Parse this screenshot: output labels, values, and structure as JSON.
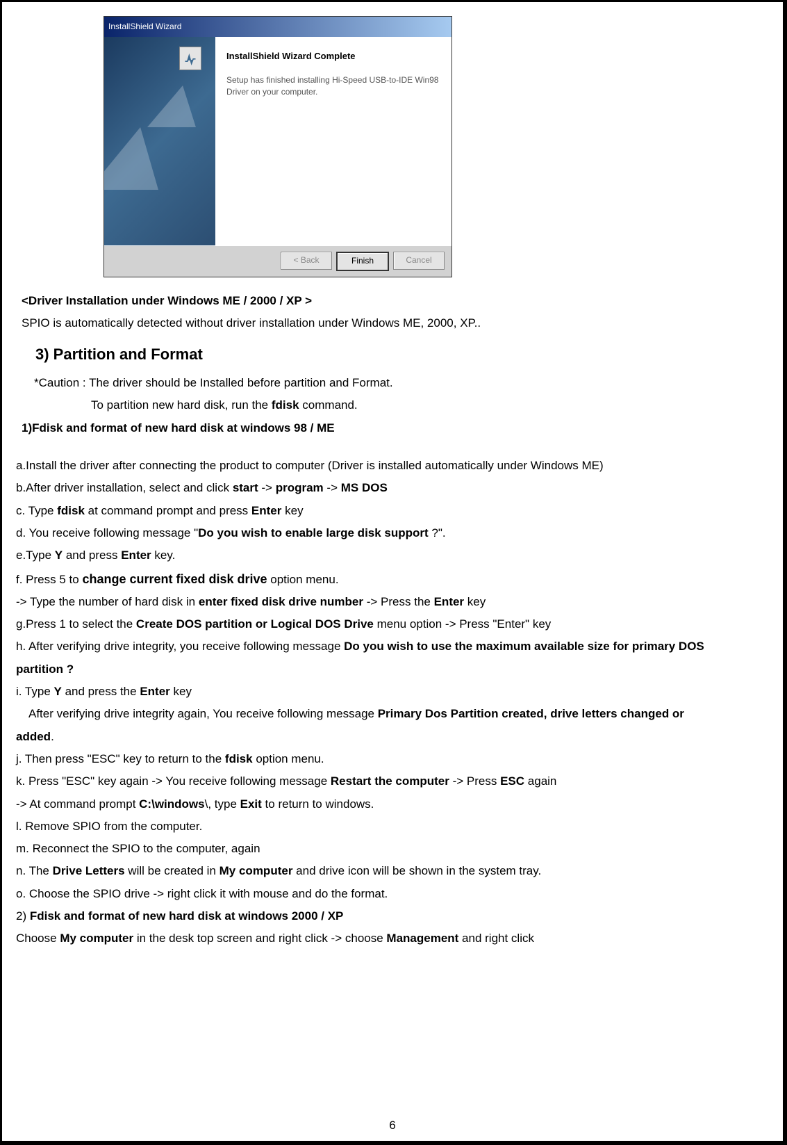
{
  "wizard": {
    "title": "InstallShield Wizard",
    "heading": "InstallShield Wizard Complete",
    "body": "Setup has finished installing Hi-Speed USB-to-IDE Win98 Driver on your computer.",
    "back": "< Back",
    "finish": "Finish",
    "cancel": "Cancel"
  },
  "t": {
    "driver_heading": "<Driver Installation under Windows ME / 2000 / XP >",
    "spio_auto": "SPIO is automatically detected without driver installation under Windows ME, 2000, XP..",
    "section3": "3) Partition and Format",
    "caution": "*Caution : The driver should be Installed before partition and Format.",
    "to_partition_pre": "To partition new hard disk, run the ",
    "fdisk": "fdisk",
    "to_partition_post": " command.",
    "sub1": "1)Fdisk and format of new hard disk at windows 98 / ME",
    "a": "a.Install the driver after connecting the product to computer (Driver is installed automatically under Windows ME)",
    "b_pre": "b.After driver installation, select and click ",
    "start": "start",
    "arrow": " -> ",
    "program": "program",
    "msdos": "MS DOS",
    "c_pre": "c. Type ",
    "c_mid": " at command prompt and press ",
    "enter": "Enter",
    "c_post": " key",
    "d_pre": "d. You receive following message \"",
    "d_bold": "Do you wish to enable large disk support",
    "d_post": " ?\".",
    "e_pre": "e.Type ",
    "Y": "Y",
    "e_mid": " and press ",
    "e_post": " key.",
    "f_pre": "f. Press 5 to ",
    "f_bold": "change current fixed disk drive",
    "f_post": " option menu.",
    "f2_pre": "-> Type the number of hard disk in ",
    "f2_bold": "enter fixed disk drive number",
    "f2_mid": " -> Press the ",
    "f2_post": " key",
    "g_pre": "g.Press 1 to select the ",
    "g_bold": "Create DOS partition or Logical DOS Drive",
    "g_post": " menu option -> Press \"Enter\" key",
    "h_pre": "h. After verifying drive integrity, you receive following message ",
    "h_bold": "Do you wish to use the maximum available size for primary DOS",
    "h2_bold": "partition ?",
    "i_pre": "i. Type ",
    "i_mid": " and press the ",
    "i_post": " key",
    "i2_pre": "After verifying drive integrity again, You receive following message ",
    "i2_bold": "Primary Dos Partition created, drive letters changed or",
    "i3_bold": "added",
    "i3_post": ".",
    "j_pre": "j. Then press \"ESC\" key to return to the ",
    "j_post": " option menu.",
    "k_pre": "k. Press \"ESC\" key again -> You receive following message ",
    "k_bold": "Restart the computer",
    "k_mid": " -> Press ",
    "ESC": "ESC",
    "k_post": " again",
    "k2_pre": "-> At command prompt ",
    "k2_bold": "C:\\windows",
    "k2_mid": "\\, type ",
    "Exit": "Exit",
    "k2_post": " to return to windows.",
    "l": "l. Remove SPIO from the computer.",
    "m": "m. Reconnect the SPIO to the computer, again",
    "n_pre": "n. The ",
    "n_b1": "Drive Letters",
    "n_mid": " will be created in ",
    "n_b2": "My computer",
    "n_post": " and drive icon will be shown in the system tray.",
    "o": "o. Choose the SPIO drive -> right click it with mouse and do the format.",
    "sub2_pre": "2) ",
    "sub2_bold": "Fdisk and format of new hard disk at windows 2000 / XP",
    "p2_pre": "Choose ",
    "p2_b1": "My computer",
    "p2_mid": " in the desk top screen and right click -> choose ",
    "p2_b2": "Management",
    "p2_post": " and right click"
  },
  "page_number": "6"
}
